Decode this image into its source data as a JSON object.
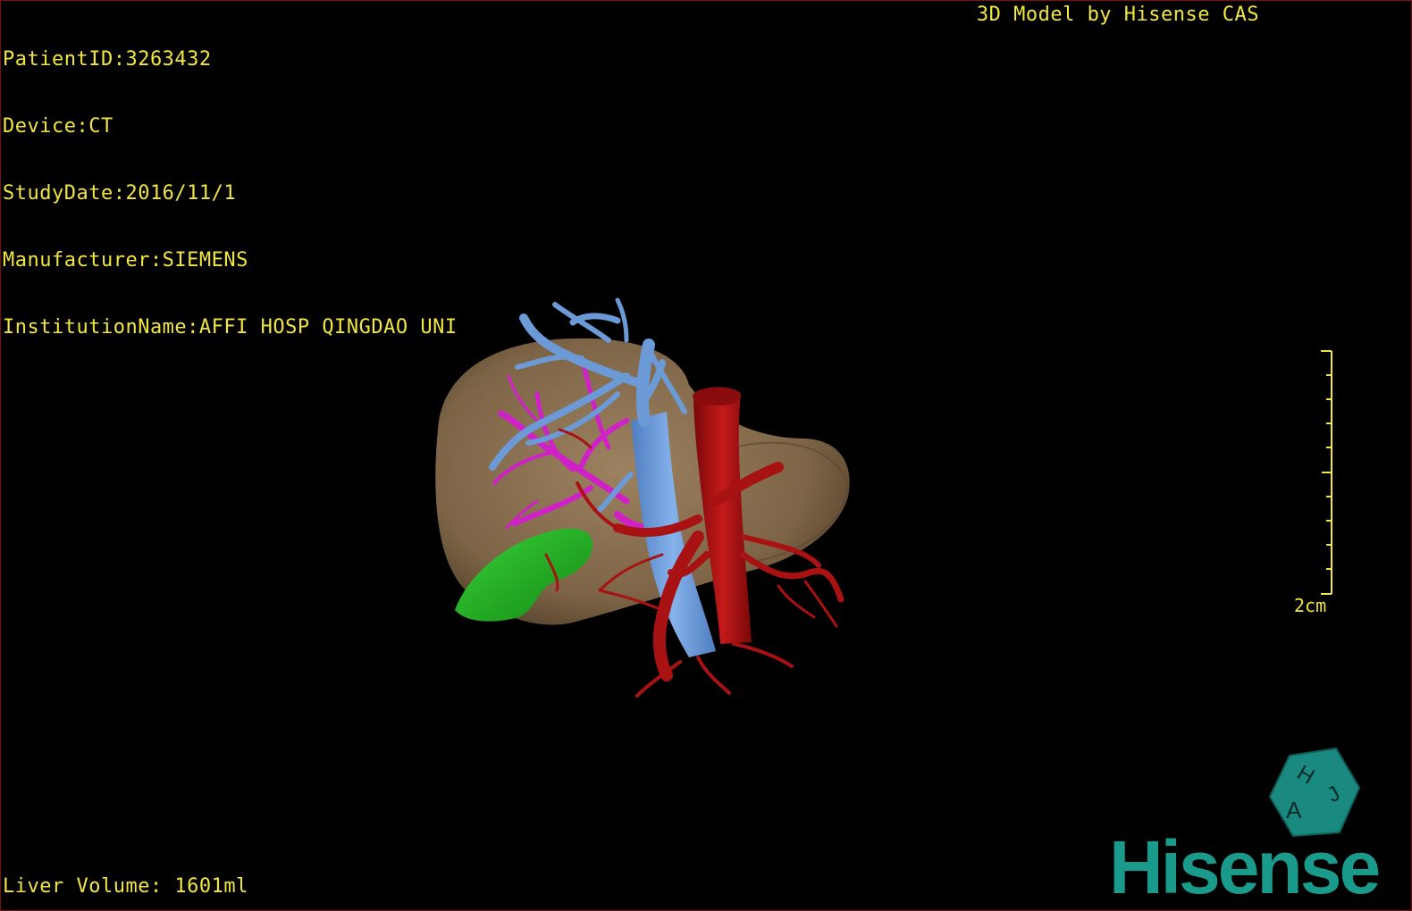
{
  "patient_info": {
    "patient_id": "PatientID:3263432",
    "device": "Device:CT",
    "study_date": "StudyDate:2016/11/1",
    "manufacturer": "Manufacturer:SIEMENS",
    "institution": "InstitutionName:AFFI HOSP QINGDAO UNI"
  },
  "brand_caption": "3D Model by Hisense CAS",
  "liver_volume": "Liver Volume: 1601ml",
  "scale_bar": {
    "label": "2cm"
  },
  "logo": {
    "wordmark": "Hisense",
    "badge_letters": [
      "H",
      "A",
      "J"
    ],
    "color": "#1a9a8a"
  },
  "model_colors": {
    "liver": "#8a7150",
    "portal_vein": "#6b9ad6",
    "hepatic_vein": "#d020c8",
    "artery": "#a81212",
    "gallbladder": "#22b022"
  },
  "text_color": "#f2e640"
}
